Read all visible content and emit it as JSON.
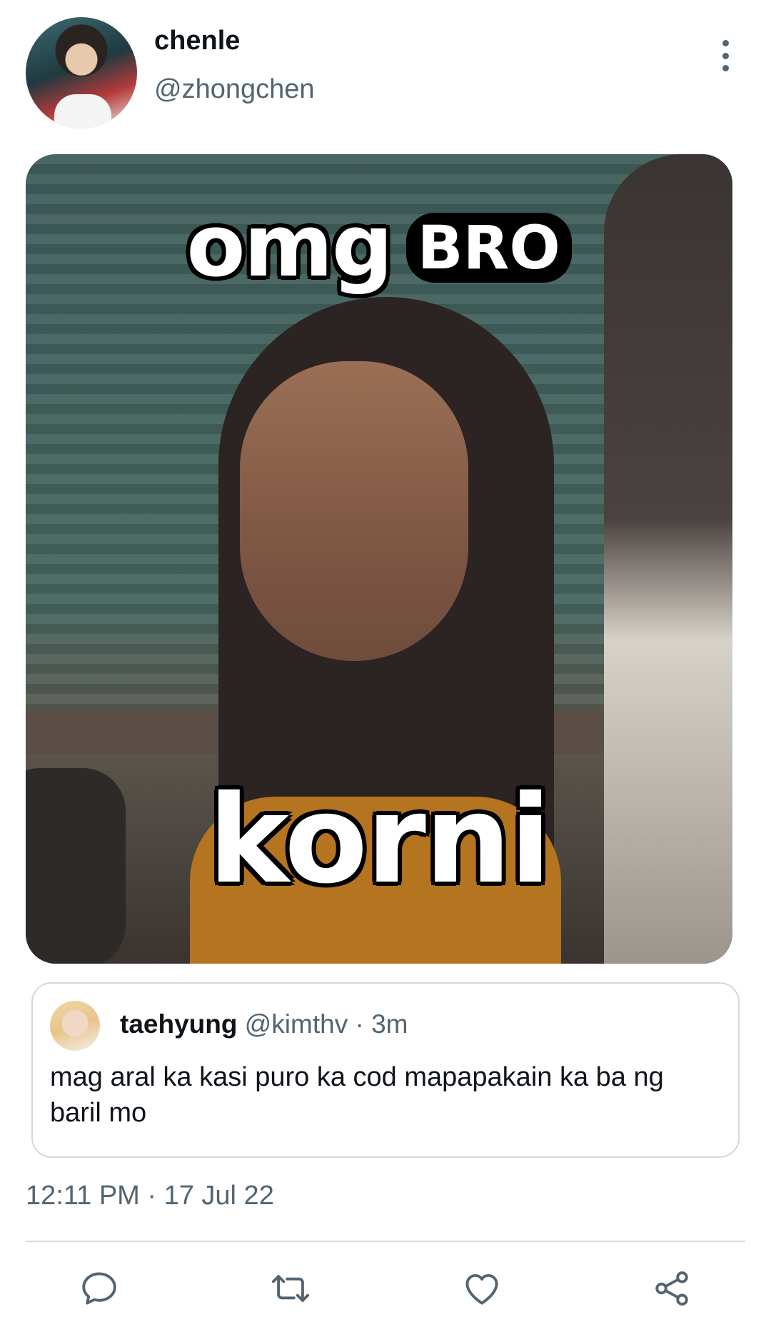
{
  "tweet": {
    "author_name": "chenle",
    "author_handle": "@zhongchen",
    "media": {
      "caption_top": "omg",
      "caption_top_sticker": "BRO",
      "caption_bottom": "korni"
    },
    "timestamp": "12:11 PM · 17 Jul 22"
  },
  "quoted_tweet": {
    "author_name": "taehyung",
    "author_handle": "@kimthv",
    "separator": " · ",
    "age": "3m",
    "text": "mag aral ka kasi puro ka cod mapapakain ka ba ng baril mo"
  },
  "actions": {
    "icons": [
      "reply-icon",
      "retweet-icon",
      "like-icon",
      "share-icon"
    ]
  },
  "colors": {
    "text_primary": "#0f1419",
    "text_secondary": "#536471",
    "border": "#cfd9de"
  }
}
